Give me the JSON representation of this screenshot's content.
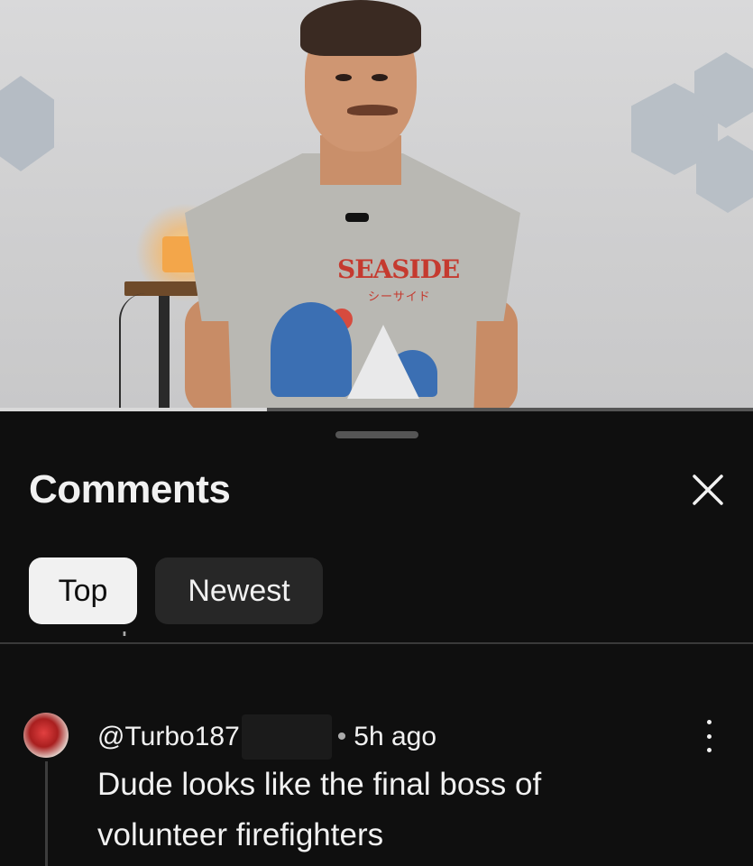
{
  "video": {
    "shirt_text": "SEASIDE",
    "shirt_subtext": "シーサイド",
    "progress": 0.355
  },
  "comments_panel": {
    "title": "Comments",
    "close_icon": "close-icon",
    "sort_options": [
      {
        "label": "Top",
        "selected": true
      },
      {
        "label": "Newest",
        "selected": false
      }
    ],
    "partial_text": "replies"
  },
  "comment": {
    "author": "@Turbo187",
    "separator": "•",
    "time": "5h ago",
    "text": "Dude looks like the final boss of volunteer firefighters",
    "more_icon": "more-vertical-icon"
  },
  "colors": {
    "background": "#0f0f0f",
    "chip_selected_bg": "#f1f1f1",
    "chip_bg": "#272727",
    "text": "#f1f1f1"
  }
}
